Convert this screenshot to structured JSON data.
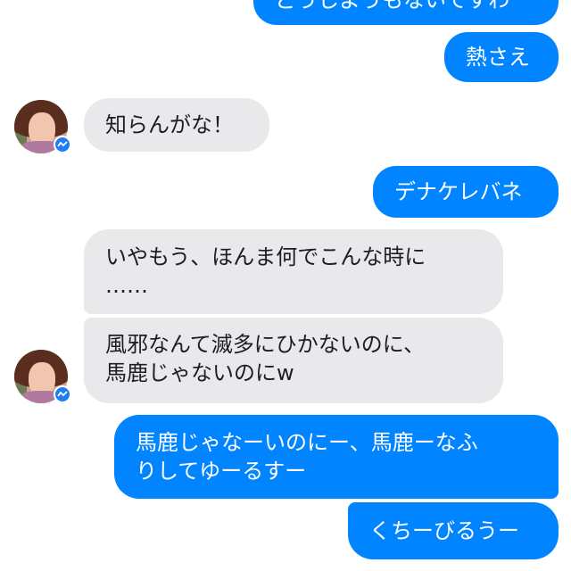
{
  "messages": [
    {
      "side": "out",
      "text": "どうしようもないですわ"
    },
    {
      "side": "out",
      "text": "熱さえ"
    },
    {
      "side": "in",
      "text": "知らんがな！"
    },
    {
      "side": "out",
      "text": "デナケレバネ"
    },
    {
      "side": "in",
      "line1": "いやもう、ほんま何でこんな時に",
      "line2": "……"
    },
    {
      "side": "in",
      "line1": "風邪なんて滅多にひかないのに、",
      "line2": "馬鹿じゃないのにw"
    },
    {
      "side": "out",
      "line1": "馬鹿じゃなーいのにー、馬鹿ーなふ",
      "line2": "りしてゆーるすー"
    },
    {
      "side": "out",
      "text": "くちーびるうー"
    }
  ],
  "colors": {
    "outgoing_bubble": "#0084ff",
    "incoming_bubble": "#e9e9eb",
    "messenger_badge": "#1e7cf5"
  },
  "icons": {
    "avatar": "contact-avatar-photo",
    "badge": "messenger-icon"
  }
}
